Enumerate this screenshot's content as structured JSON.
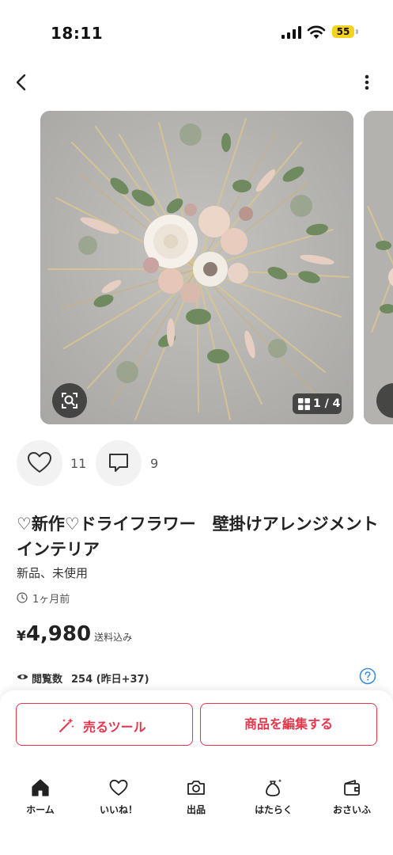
{
  "status_bar": {
    "time": "18:11",
    "battery": "55",
    "battery_color": "#f5d21e"
  },
  "header": {
    "back_icon": "chevron-left-icon",
    "menu_icon": "more-vertical-icon"
  },
  "gallery": {
    "counter": "1 / 4",
    "current_index": 1,
    "total": 4,
    "lens_icon": "image-search-icon"
  },
  "actions": {
    "likes": "11",
    "comments": "9"
  },
  "item": {
    "title": "♡新作♡ドライフラワー　壁掛けアレンジメント　インテリア",
    "condition": "新品、未使用",
    "posted": "1ヶ月前",
    "price_yen": "¥",
    "price": "4,980",
    "shipping": "送料込み",
    "views_label": "閲覧数",
    "views_value": "254 (昨日+37)"
  },
  "bottom_actions": {
    "sell_tools": "売るツール",
    "edit_item": "商品を編集する",
    "accent_color": "#e5364b"
  },
  "tabs": [
    {
      "label": "ホーム",
      "icon": "home-icon"
    },
    {
      "label": "いいね！",
      "icon": "heart-icon"
    },
    {
      "label": "出品",
      "icon": "camera-icon"
    },
    {
      "label": "はたらく",
      "icon": "money-bag-icon"
    },
    {
      "label": "おさいふ",
      "icon": "wallet-icon"
    }
  ]
}
